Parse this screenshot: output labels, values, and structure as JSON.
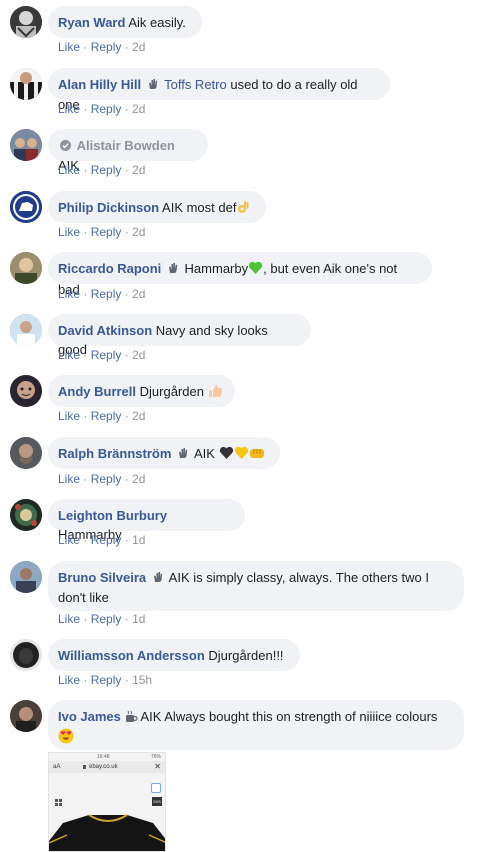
{
  "comments": [
    {
      "name": "Ryan Ward",
      "text": "Aik easily.",
      "time": "2d"
    },
    {
      "name": "Alan Hilly Hill",
      "tag": "Toffs Retro",
      "text": "used to do a really old one",
      "time": "2d"
    },
    {
      "name": "Alistair Bowden",
      "text": "AIK",
      "time": "2d"
    },
    {
      "name": "Philip Dickinson",
      "text": "AIK most def",
      "time": "2d"
    },
    {
      "name": "Riccardo Raponi",
      "text_a": "Hammarby",
      "text_b": ", but even Aik one's not bad",
      "time": "2d"
    },
    {
      "name": "David Atkinson",
      "text": "Navy and sky looks good",
      "time": "2d"
    },
    {
      "name": "Andy Burrell",
      "text": "Djurgården",
      "time": "2d"
    },
    {
      "name": "Ralph Brännström",
      "text": "AIK",
      "time": "2d"
    },
    {
      "name": "Leighton Burbury",
      "text": "Hammarby",
      "time": "1d"
    },
    {
      "name": "Bruno Silveira",
      "text_line1": "AIK is simply classy, always. The others two I",
      "text_line2": "don't like",
      "time": "1d"
    },
    {
      "name": "Williamsson Andersson",
      "text": "Djurgården!!!",
      "time": "15h"
    },
    {
      "name": "Ivo James",
      "text": "AIK Always bought this on strength of niiiice colours",
      "time": ""
    }
  ],
  "actions": {
    "like": "Like",
    "reply": "Reply",
    "sep": "·"
  },
  "attachment": {
    "status_time": "16:48",
    "status_battery": "76%",
    "aa": "aA",
    "domain": "ebay.co.uk",
    "size_label": "2XS"
  },
  "icons": [
    "wave-badge-icon",
    "verified-check-icon",
    "ok-hand-emoji-icon",
    "green-heart-emoji-icon",
    "thumbs-up-emoji-icon",
    "black-heart-emoji-icon",
    "yellow-heart-emoji-icon",
    "fist-emoji-icon",
    "coffee-emoji-icon",
    "heart-eyes-emoji-icon"
  ]
}
